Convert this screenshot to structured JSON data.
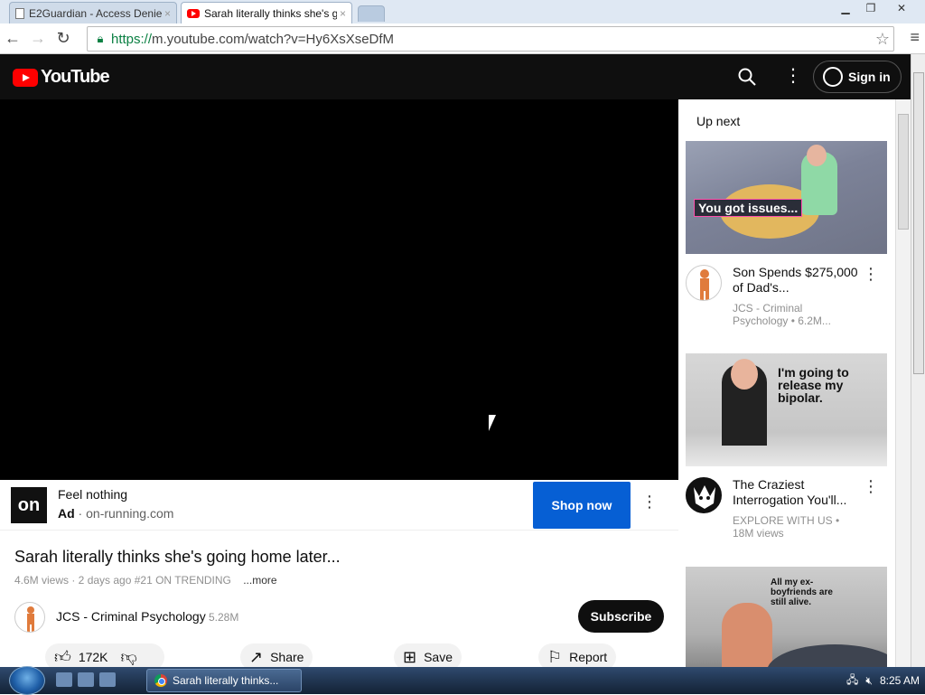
{
  "browser": {
    "tabs": [
      {
        "title": "E2Guardian - Access Denie",
        "close": "×"
      },
      {
        "title": "Sarah literally thinks she's g",
        "close": "×"
      }
    ],
    "url_scheme": "https://",
    "url_rest": "m.youtube.com/watch?v=Hy6XsXseDfM"
  },
  "header": {
    "logo_text": "YouTube",
    "signin_label": "Sign in"
  },
  "ad": {
    "logo_text": "on",
    "title": "Feel nothing",
    "ad_label": "Ad",
    "separator": " · ",
    "domain": "on-running.com",
    "cta": "Shop now"
  },
  "video": {
    "title": "Sarah literally thinks she's going home later...",
    "meta": "4.6M views · 2 days ago #21 ON TRENDING",
    "more": "...more",
    "channel": "JCS - Criminal Psychology",
    "subs": "5.28M",
    "subscribe": "Subscribe",
    "likes": "172K",
    "share": "Share",
    "save": "Save",
    "report": "Report"
  },
  "sidebar": {
    "heading": "Up next",
    "items": [
      {
        "thumb_caption": "You got issues...",
        "title": "Son Spends $275,000 of Dad's...",
        "meta": "JCS - Criminal Psychology • 6.2M..."
      },
      {
        "thumb_caption": "I'm going to release my bipolar.",
        "title": "The Craziest Interrogation You'll...",
        "meta": "EXPLORE WITH US • 18M views"
      },
      {
        "thumb_caption": "All my ex-boyfriends are still alive."
      }
    ]
  },
  "taskbar": {
    "task_label": "Sarah literally thinks...",
    "clock": "8:25 AM"
  }
}
